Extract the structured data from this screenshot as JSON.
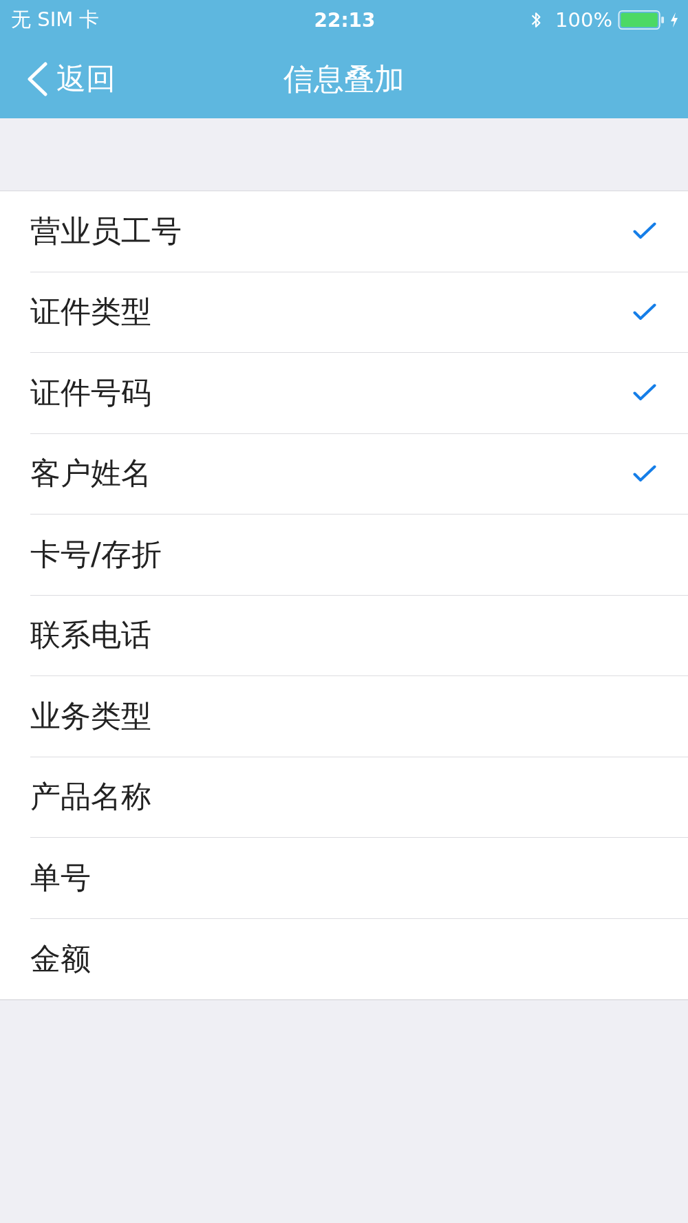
{
  "status_bar": {
    "carrier": "无 SIM 卡",
    "time": "22:13",
    "battery": "100%"
  },
  "nav_bar": {
    "back": "返回",
    "title": "信息叠加"
  },
  "options": [
    {
      "label": "营业员工号",
      "checked": true
    },
    {
      "label": "证件类型",
      "checked": true
    },
    {
      "label": "证件号码",
      "checked": true
    },
    {
      "label": "客户姓名",
      "checked": true
    },
    {
      "label": "卡号/存折",
      "checked": false
    },
    {
      "label": "联系电话",
      "checked": false
    },
    {
      "label": "业务类型",
      "checked": false
    },
    {
      "label": "产品名称",
      "checked": false
    },
    {
      "label": "单号",
      "checked": false
    },
    {
      "label": "金额",
      "checked": false
    }
  ]
}
